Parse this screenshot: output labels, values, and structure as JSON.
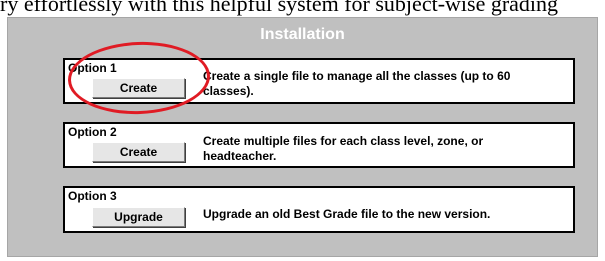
{
  "top_strip_text": "ry effortlessly with this helpful system for subject-wise grading",
  "dialog": {
    "title": "Installation",
    "options": [
      {
        "label": "Option 1",
        "button": "Create",
        "description": "Create a single file to manage all the classes (up to 60 classes)."
      },
      {
        "label": "Option 2",
        "button": "Create",
        "description": "Create multiple files for each class level, zone, or headteacher."
      },
      {
        "label": "Option 3",
        "button": "Upgrade",
        "description": "Upgrade an old Best Grade file to the new version."
      }
    ]
  },
  "annotation": {
    "shape": "ellipse",
    "color": "#e01b24",
    "target": "Option 1"
  },
  "colors": {
    "panel_bg": "#c0c0c0",
    "title_text": "#ffffff",
    "annotation": "#e01b24"
  }
}
